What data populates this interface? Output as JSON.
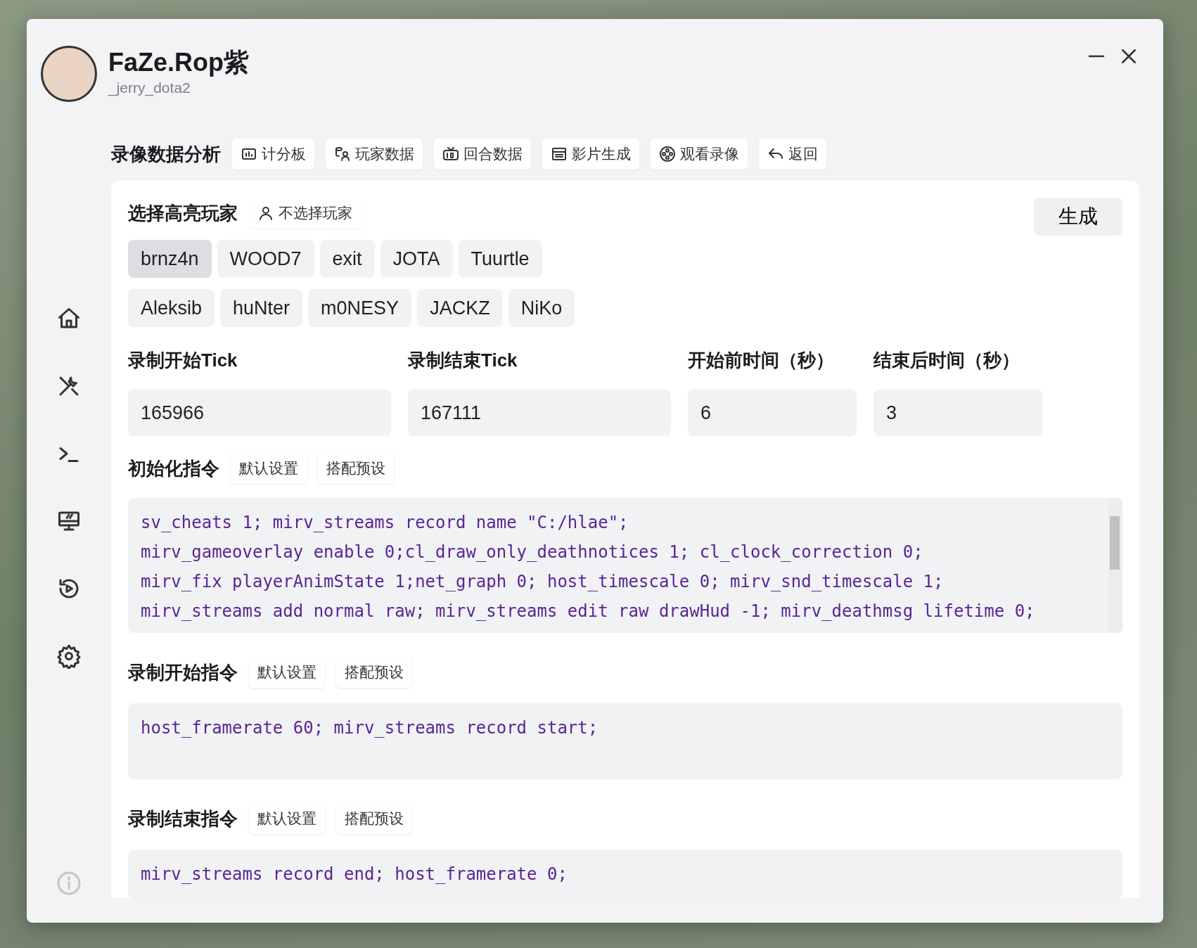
{
  "profile": {
    "name": "FaZe.Rop紫",
    "handle": "_jerry_dota2"
  },
  "toolbar": {
    "title": "录像数据分析",
    "buttons": [
      {
        "label": "计分板"
      },
      {
        "label": "玩家数据"
      },
      {
        "label": "回合数据"
      },
      {
        "label": "影片生成"
      },
      {
        "label": "观看录像"
      },
      {
        "label": "返回"
      }
    ]
  },
  "highlight": {
    "title": "选择高亮玩家",
    "clear_button": "不选择玩家",
    "generate_button": "生成",
    "player_rows": [
      [
        {
          "name": "brnz4n",
          "selected": true
        },
        {
          "name": "WOOD7",
          "selected": false
        },
        {
          "name": "exit",
          "selected": false
        },
        {
          "name": "JOTA",
          "selected": false
        },
        {
          "name": "Tuurtle",
          "selected": false
        }
      ],
      [
        {
          "name": "Aleksib",
          "selected": false
        },
        {
          "name": "huNter",
          "selected": false
        },
        {
          "name": "m0NESY",
          "selected": false
        },
        {
          "name": "JACKZ",
          "selected": false
        },
        {
          "name": "NiKo",
          "selected": false
        }
      ]
    ]
  },
  "fields": [
    {
      "label": "录制开始Tick",
      "value": "165966"
    },
    {
      "label": "录制结束Tick",
      "value": "167111"
    },
    {
      "label": "开始前时间（秒）",
      "value": "6"
    },
    {
      "label": "结束后时间（秒）",
      "value": "3"
    }
  ],
  "commands": [
    {
      "title": "初始化指令",
      "buttons": [
        "默认设置",
        "搭配预设"
      ],
      "lines": [
        "sv_cheats 1; mirv_streams record name \"C:/hlae\";",
        "mirv_gameoverlay enable 0;cl_draw_only_deathnotices 1; cl_clock_correction 0;",
        "mirv_fix playerAnimState 1;net_graph 0; host_timescale 0; mirv_snd_timescale 1;",
        "mirv_streams add normal raw; mirv_streams edit raw drawHud -1; mirv_deathmsg lifetime 0;"
      ]
    },
    {
      "title": "录制开始指令",
      "buttons": [
        "默认设置",
        "搭配预设"
      ],
      "lines": [
        "host_framerate 60; mirv_streams record start;"
      ]
    },
    {
      "title": "录制结束指令",
      "buttons": [
        "默认设置",
        "搭配预设"
      ],
      "lines": [
        "mirv_streams record end; host_framerate 0;"
      ]
    }
  ]
}
